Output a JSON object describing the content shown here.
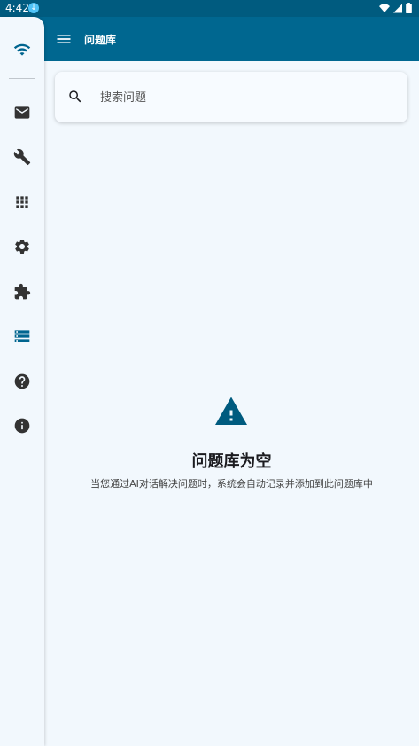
{
  "status_bar": {
    "time": "4:42"
  },
  "app_bar": {
    "title": "问题库"
  },
  "search": {
    "placeholder": "搜索问题"
  },
  "empty_state": {
    "title": "问题库为空",
    "description": "当您通过AI对话解决问题时，系统会自动记录并添加到此问题库中"
  },
  "nav_rail": {
    "items": [
      {
        "icon": "wifi-icon"
      },
      {
        "icon": "mail-icon"
      },
      {
        "icon": "wrench-icon"
      },
      {
        "icon": "apps-grid-icon"
      },
      {
        "icon": "gear-icon"
      },
      {
        "icon": "puzzle-icon"
      },
      {
        "icon": "storage-list-icon",
        "active": true
      },
      {
        "icon": "help-icon"
      },
      {
        "icon": "info-icon"
      }
    ]
  },
  "colors": {
    "primary": "#006790",
    "status_bar": "#005b7f",
    "background": "#f2f8fd",
    "icon_active": "#00658f",
    "icon": "#333333"
  }
}
